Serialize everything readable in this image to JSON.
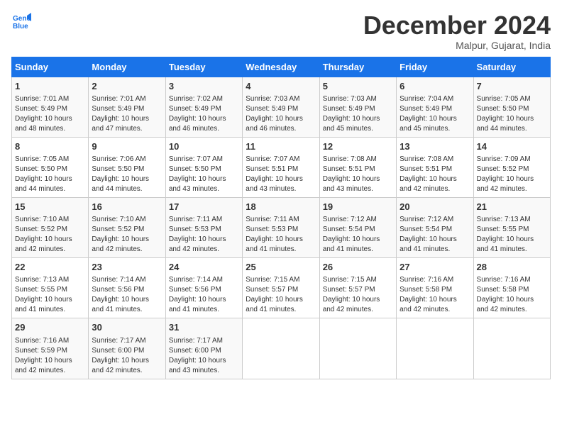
{
  "logo": {
    "line1": "General",
    "line2": "Blue"
  },
  "title": "December 2024",
  "subtitle": "Malpur, Gujarat, India",
  "days_of_week": [
    "Sunday",
    "Monday",
    "Tuesday",
    "Wednesday",
    "Thursday",
    "Friday",
    "Saturday"
  ],
  "weeks": [
    [
      {
        "day": 1,
        "info": "Sunrise: 7:01 AM\nSunset: 5:49 PM\nDaylight: 10 hours\nand 48 minutes."
      },
      {
        "day": 2,
        "info": "Sunrise: 7:01 AM\nSunset: 5:49 PM\nDaylight: 10 hours\nand 47 minutes."
      },
      {
        "day": 3,
        "info": "Sunrise: 7:02 AM\nSunset: 5:49 PM\nDaylight: 10 hours\nand 46 minutes."
      },
      {
        "day": 4,
        "info": "Sunrise: 7:03 AM\nSunset: 5:49 PM\nDaylight: 10 hours\nand 46 minutes."
      },
      {
        "day": 5,
        "info": "Sunrise: 7:03 AM\nSunset: 5:49 PM\nDaylight: 10 hours\nand 45 minutes."
      },
      {
        "day": 6,
        "info": "Sunrise: 7:04 AM\nSunset: 5:49 PM\nDaylight: 10 hours\nand 45 minutes."
      },
      {
        "day": 7,
        "info": "Sunrise: 7:05 AM\nSunset: 5:50 PM\nDaylight: 10 hours\nand 44 minutes."
      }
    ],
    [
      {
        "day": 8,
        "info": "Sunrise: 7:05 AM\nSunset: 5:50 PM\nDaylight: 10 hours\nand 44 minutes."
      },
      {
        "day": 9,
        "info": "Sunrise: 7:06 AM\nSunset: 5:50 PM\nDaylight: 10 hours\nand 44 minutes."
      },
      {
        "day": 10,
        "info": "Sunrise: 7:07 AM\nSunset: 5:50 PM\nDaylight: 10 hours\nand 43 minutes."
      },
      {
        "day": 11,
        "info": "Sunrise: 7:07 AM\nSunset: 5:51 PM\nDaylight: 10 hours\nand 43 minutes."
      },
      {
        "day": 12,
        "info": "Sunrise: 7:08 AM\nSunset: 5:51 PM\nDaylight: 10 hours\nand 43 minutes."
      },
      {
        "day": 13,
        "info": "Sunrise: 7:08 AM\nSunset: 5:51 PM\nDaylight: 10 hours\nand 42 minutes."
      },
      {
        "day": 14,
        "info": "Sunrise: 7:09 AM\nSunset: 5:52 PM\nDaylight: 10 hours\nand 42 minutes."
      }
    ],
    [
      {
        "day": 15,
        "info": "Sunrise: 7:10 AM\nSunset: 5:52 PM\nDaylight: 10 hours\nand 42 minutes."
      },
      {
        "day": 16,
        "info": "Sunrise: 7:10 AM\nSunset: 5:52 PM\nDaylight: 10 hours\nand 42 minutes."
      },
      {
        "day": 17,
        "info": "Sunrise: 7:11 AM\nSunset: 5:53 PM\nDaylight: 10 hours\nand 42 minutes."
      },
      {
        "day": 18,
        "info": "Sunrise: 7:11 AM\nSunset: 5:53 PM\nDaylight: 10 hours\nand 41 minutes."
      },
      {
        "day": 19,
        "info": "Sunrise: 7:12 AM\nSunset: 5:54 PM\nDaylight: 10 hours\nand 41 minutes."
      },
      {
        "day": 20,
        "info": "Sunrise: 7:12 AM\nSunset: 5:54 PM\nDaylight: 10 hours\nand 41 minutes."
      },
      {
        "day": 21,
        "info": "Sunrise: 7:13 AM\nSunset: 5:55 PM\nDaylight: 10 hours\nand 41 minutes."
      }
    ],
    [
      {
        "day": 22,
        "info": "Sunrise: 7:13 AM\nSunset: 5:55 PM\nDaylight: 10 hours\nand 41 minutes."
      },
      {
        "day": 23,
        "info": "Sunrise: 7:14 AM\nSunset: 5:56 PM\nDaylight: 10 hours\nand 41 minutes."
      },
      {
        "day": 24,
        "info": "Sunrise: 7:14 AM\nSunset: 5:56 PM\nDaylight: 10 hours\nand 41 minutes."
      },
      {
        "day": 25,
        "info": "Sunrise: 7:15 AM\nSunset: 5:57 PM\nDaylight: 10 hours\nand 41 minutes."
      },
      {
        "day": 26,
        "info": "Sunrise: 7:15 AM\nSunset: 5:57 PM\nDaylight: 10 hours\nand 42 minutes."
      },
      {
        "day": 27,
        "info": "Sunrise: 7:16 AM\nSunset: 5:58 PM\nDaylight: 10 hours\nand 42 minutes."
      },
      {
        "day": 28,
        "info": "Sunrise: 7:16 AM\nSunset: 5:58 PM\nDaylight: 10 hours\nand 42 minutes."
      }
    ],
    [
      {
        "day": 29,
        "info": "Sunrise: 7:16 AM\nSunset: 5:59 PM\nDaylight: 10 hours\nand 42 minutes."
      },
      {
        "day": 30,
        "info": "Sunrise: 7:17 AM\nSunset: 6:00 PM\nDaylight: 10 hours\nand 42 minutes."
      },
      {
        "day": 31,
        "info": "Sunrise: 7:17 AM\nSunset: 6:00 PM\nDaylight: 10 hours\nand 43 minutes."
      },
      null,
      null,
      null,
      null
    ]
  ]
}
